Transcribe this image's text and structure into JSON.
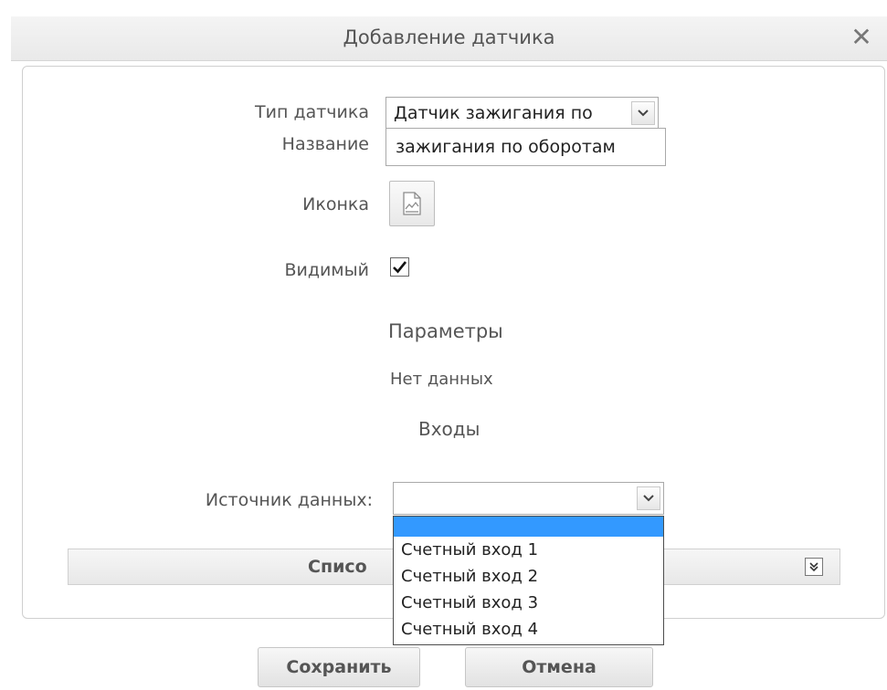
{
  "dialog": {
    "title": "Добавление датчика",
    "close_icon": "close-icon"
  },
  "form": {
    "type_label": "Тип датчика",
    "type_value": "Датчик зажигания по",
    "name_label": "Название",
    "name_value": "зажигания по оборотам",
    "icon_label": "Иконка",
    "visible_label": "Видимый",
    "visible_checked": true
  },
  "sections": {
    "params_heading": "Параметры",
    "params_empty": "Нет данных",
    "inputs_heading": "Входы"
  },
  "source": {
    "label": "Источник данных:",
    "value": "",
    "options": [
      "",
      "Счетный вход 1",
      "Счетный вход 2",
      "Счетный вход 3",
      "Счетный вход 4"
    ],
    "highlighted_index": 0
  },
  "list_section": {
    "title_visible": "Списо"
  },
  "buttons": {
    "save": "Сохранить",
    "cancel": "Отмена"
  },
  "colors": {
    "highlight": "#3399ff"
  }
}
